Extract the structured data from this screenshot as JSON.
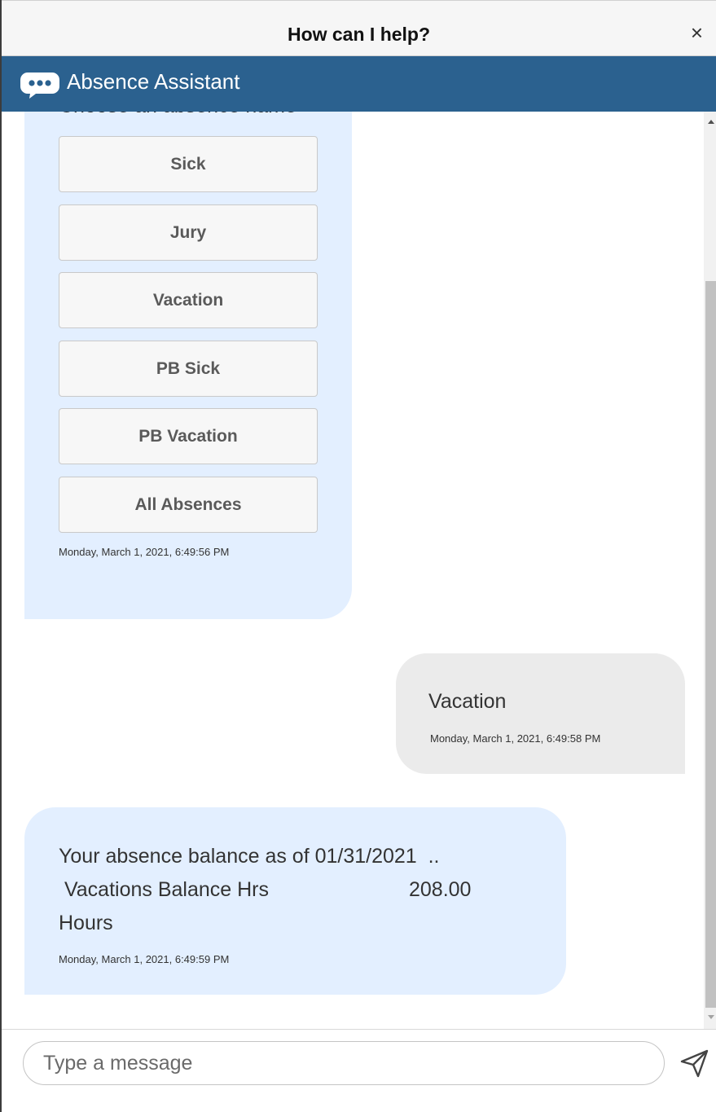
{
  "window": {
    "title": "How can I help?",
    "close_label": "×"
  },
  "assistant": {
    "name": "Absence Assistant",
    "icon": "chat-bubble-icon",
    "bar_color": "#2b618f"
  },
  "messages": {
    "choice_prompt": {
      "text": "Choose an absence name",
      "options": [
        "Sick",
        "Jury",
        "Vacation",
        "PB Sick",
        "PB Vacation",
        "All Absences"
      ],
      "timestamp": "Monday, March 1, 2021, 6:49:56 PM"
    },
    "user_reply": {
      "text": "Vacation",
      "timestamp": "Monday, March 1, 2021, 6:49:58 PM"
    },
    "balance": {
      "line1": "Your absence balance as of 01/31/2021  ..",
      "line2_label": " Vacations Balance Hrs",
      "line2_value": "208.00",
      "line3": "Hours",
      "timestamp": "Monday, March 1, 2021, 6:49:59 PM"
    }
  },
  "composer": {
    "placeholder": "Type a message",
    "value": ""
  },
  "colors": {
    "bot_bubble": "#e3efff",
    "user_bubble": "#ebebeb"
  }
}
